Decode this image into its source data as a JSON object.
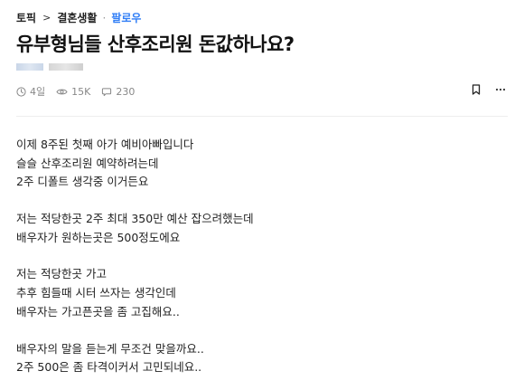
{
  "breadcrumb": {
    "topic": "토픽",
    "separator": ">",
    "category": "결혼생활",
    "dot": "·",
    "follow": "팔로우"
  },
  "post": {
    "title": "유부형님들 산후조리원 돈값하나요?",
    "meta": {
      "time": "4일",
      "views": "15K",
      "comments": "230"
    },
    "paragraphs": [
      [
        "이제 8주된 첫째 아가 예비아빠입니다",
        "슬슬 산후조리원 예약하려는데",
        "2주 디폴트 생각중 이거든요"
      ],
      [
        "저는 적당한곳 2주 최대 350만 예산 잡으려했는데",
        "배우자가 원하는곳은 500정도에요"
      ],
      [
        "저는 적당한곳 가고",
        "추후 힘들때 시터 쓰자는 생각인데",
        "배우자는 가고픈곳을 좀 고집해요.."
      ],
      [
        "배우자의 말을 듣는게 무조건 맞을까요..",
        "2주 500은 좀 타격이커서 고민되네요.."
      ]
    ]
  },
  "icons": {
    "time": "clock-icon",
    "views": "eye-icon",
    "comments": "comment-icon",
    "bookmark": "bookmark-icon",
    "more": "more-icon"
  },
  "colors": {
    "accent": "#2f7df6",
    "meta_text": "#888888",
    "divider": "#eeeeee"
  }
}
